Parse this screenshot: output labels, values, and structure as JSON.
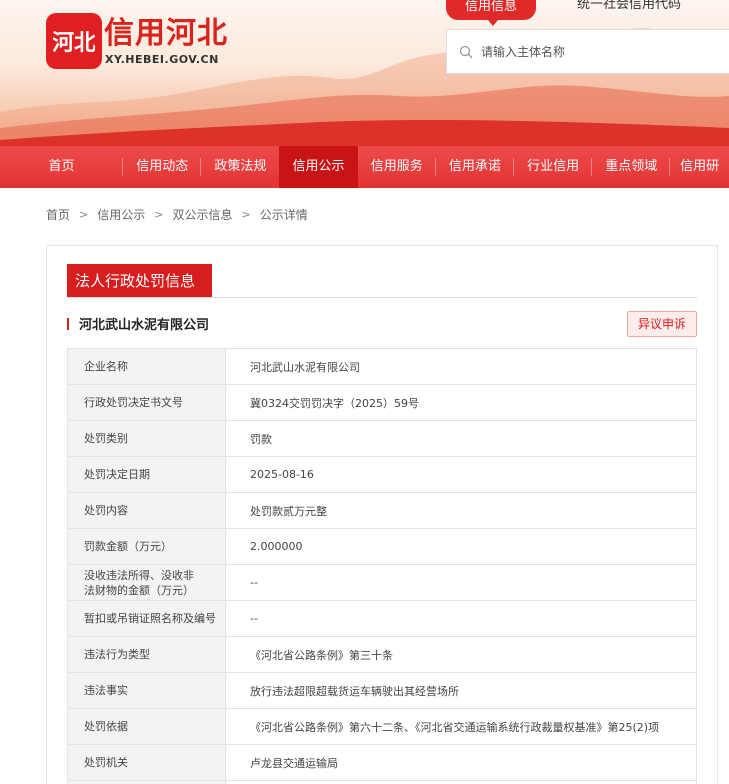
{
  "header": {
    "logo_title": "信用河北",
    "logo_url": "XY.HEBEI.GOV.CN",
    "logo_glyph": "河北",
    "search_tabs": [
      "信用信息",
      "统一社会信用代码"
    ],
    "search_placeholder": "请输入主体名称"
  },
  "nav": {
    "items": [
      "首页",
      "信用动态",
      "政策法规",
      "信用公示",
      "信用服务",
      "信用承诺",
      "行业信用",
      "重点领域",
      "信用研"
    ],
    "active_index": 3
  },
  "breadcrumb": [
    "首页",
    "信用公示",
    "双公示信息",
    "公示详情"
  ],
  "panel": {
    "tab_title": "法人行政处罚信息",
    "company_name": "河北武山水泥有限公司",
    "appeal_label": "异议申诉"
  },
  "table": [
    {
      "k": "企业名称",
      "v": "河北武山水泥有限公司"
    },
    {
      "k": "行政处罚决定书文号",
      "v": "冀0324交罚罚决字（2025）59号"
    },
    {
      "k": "处罚类别",
      "v": "罚款"
    },
    {
      "k": "处罚决定日期",
      "v": "2025-08-16"
    },
    {
      "k": "处罚内容",
      "v": "处罚款贰万元整"
    },
    {
      "k": "罚款金额（万元）",
      "v": "2.000000"
    },
    {
      "k": "没收违法所得、没收非法财物的金额（万元）",
      "v": "--"
    },
    {
      "k": "暂扣或吊销证照名称及编号",
      "v": "--"
    },
    {
      "k": "违法行为类型",
      "v": "《河北省公路条例》第三十条"
    },
    {
      "k": "违法事实",
      "v": "放行违法超限超载货运车辆驶出其经营场所"
    },
    {
      "k": "处罚依据",
      "v": "《河北省公路条例》第六十二条、《河北省交通运输系统行政裁量权基准》第25(2)项"
    },
    {
      "k": "处罚机关",
      "v": "卢龙县交通运输局"
    },
    {
      "k": "",
      "v": ""
    }
  ],
  "colors": {
    "brand_red": "#d71e1e",
    "nav_red": "#e23434",
    "nav_active": "#c81414"
  }
}
